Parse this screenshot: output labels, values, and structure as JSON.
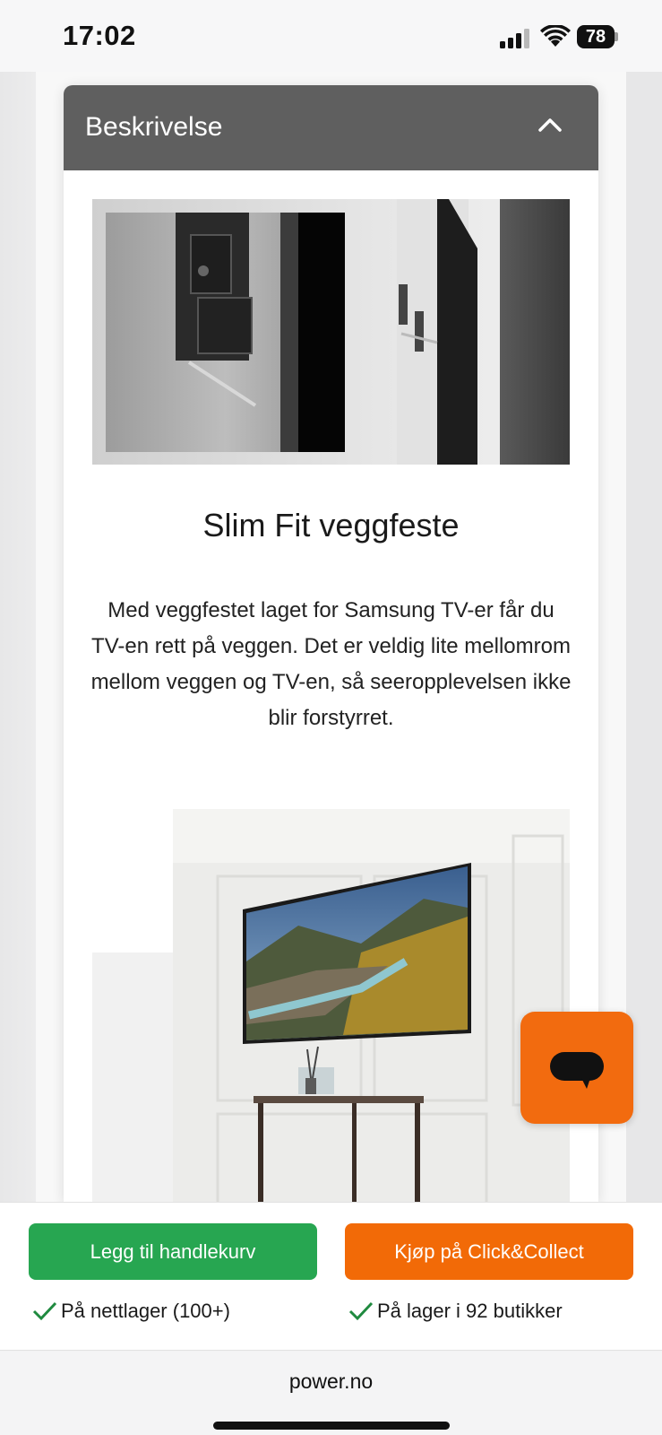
{
  "status_bar": {
    "time": "17:02",
    "battery": "78",
    "icons": [
      "signal-icon",
      "wifi-icon",
      "battery-icon"
    ]
  },
  "accordion": {
    "title": "Beskrivelse",
    "chevron_icon": "chevron-up-icon",
    "heading": "Slim Fit veggfeste",
    "body": "Med veggfestet laget for Samsung TV-er får du TV-en rett på veggen. Det er veldig lite mellomrom mellom veggen og TV-en, så seeropplevelsen ikke blir forstyrret."
  },
  "chat": {
    "icon": "chat-bubble-icon",
    "color": "#f26b0f"
  },
  "purchase": {
    "cart_label": "Legg til handlekurv",
    "collect_label": "Kjøp på Click&Collect",
    "online_stock": "På nettlager (100+)",
    "store_stock": "På lager i 92 butikker",
    "cart_color": "#27a651",
    "collect_color": "#f26a07"
  },
  "browser": {
    "url": "power.no"
  }
}
